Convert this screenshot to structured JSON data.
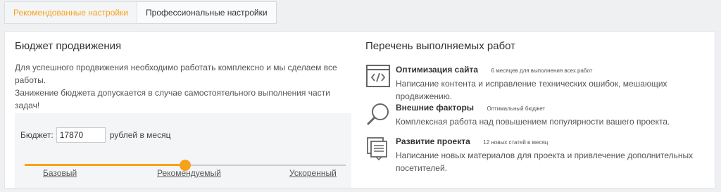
{
  "tabs": [
    {
      "label": "Рекомендованные настройки",
      "active": true
    },
    {
      "label": "Профессиональные настройки",
      "active": false
    }
  ],
  "budget_section": {
    "title": "Бюджет продвижения",
    "desc_line1": "Для успешного продвижения необходимо работать комплексно и мы сделаем все работы.",
    "desc_line2": "Занижение бюджета допускается в случае самостоятельного выполнения части задач!",
    "budget_label": "Бюджет:",
    "budget_value": "17870",
    "budget_unit": "рублей в месяц",
    "slider_level": 0.5,
    "levels": [
      "Базовый",
      "Рекомендуемый",
      "Ускоренный"
    ]
  },
  "works_section": {
    "title": "Перечень выполняемых работ",
    "items": [
      {
        "title": "Оптимизация сайта",
        "note": "6 месяцев для выполнения всех работ",
        "desc": "Написание контента и исправление технических ошибок, мешающих продвижению.",
        "icon": "code-window-icon"
      },
      {
        "title": "Внешние факторы",
        "note": "Оптимальный бюджет",
        "desc": "Комплексная работа над повышением популярности вашего проекта.",
        "icon": "magnifier-icon"
      },
      {
        "title": "Развитие проекта",
        "note": "12 новых статей в месяц",
        "desc": "Написание новых материалов для проекта и привлечение дополнительных посетителей.",
        "icon": "documents-icon"
      }
    ]
  },
  "colors": {
    "accent": "#f7a21b"
  }
}
